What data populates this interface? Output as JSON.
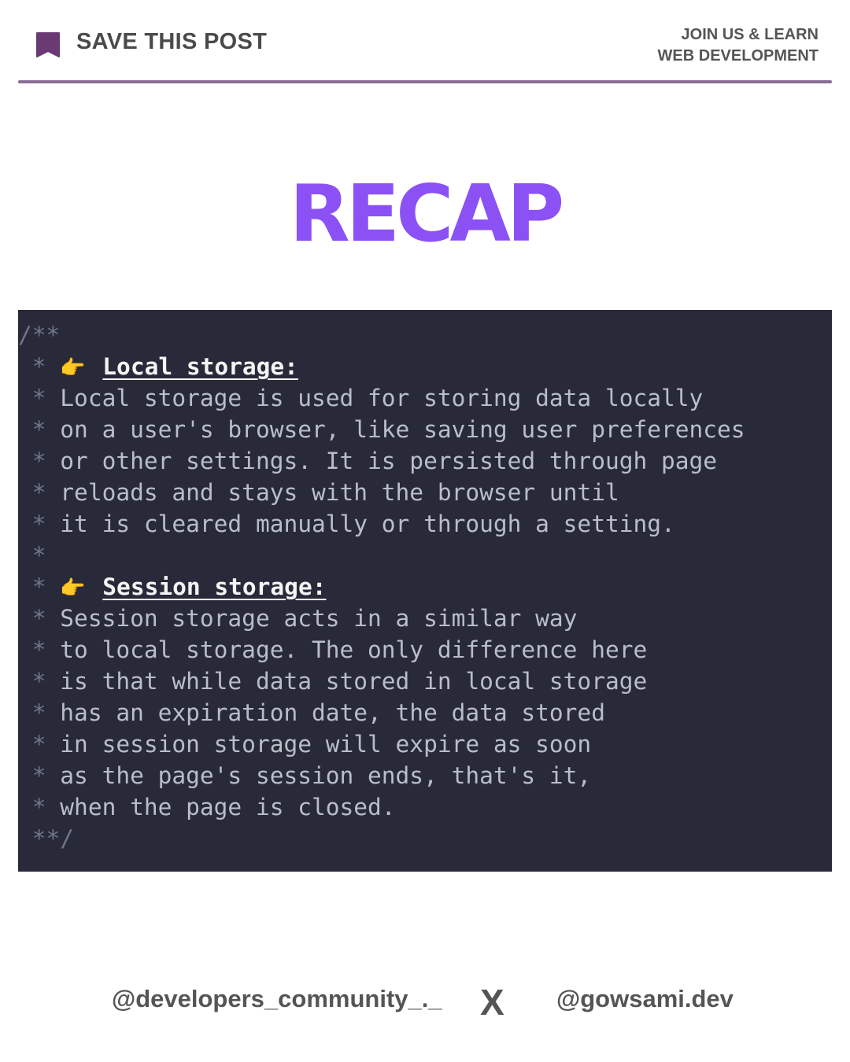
{
  "header": {
    "save_label": "SAVE THIS POST",
    "join_line1": "JOIN US & LEARN",
    "join_line2": "WEB DEVELOPMENT",
    "bookmark_icon": "bookmark-icon",
    "accent_color": "#8a6d96"
  },
  "title": "RECAP",
  "title_color": "#8b51f5",
  "code": {
    "background": "#282a3a",
    "open_comment": "/**",
    "star": "*",
    "pointer_emoji": "👉",
    "local_heading": "Local storage:",
    "local_lines": [
      "Local storage is used for storing data locally",
      "on a user's browser, like saving user preferences",
      "or other settings. It is persisted through page",
      "reloads and stays with the browser until",
      "it is cleared manually or through a setting."
    ],
    "session_heading": "Session storage:",
    "session_lines": [
      "Session storage acts in a similar way",
      "to local storage. The only difference here",
      "is that while data stored in local storage",
      "has an expiration date, the data stored",
      "in session storage will expire as soon",
      "as the page's session ends, that's it,",
      "when the page is closed."
    ],
    "close_comment": "**/"
  },
  "footer": {
    "left_handle": "@developers_community_._",
    "separator": "X",
    "right_handle": "@gowsami.dev"
  }
}
